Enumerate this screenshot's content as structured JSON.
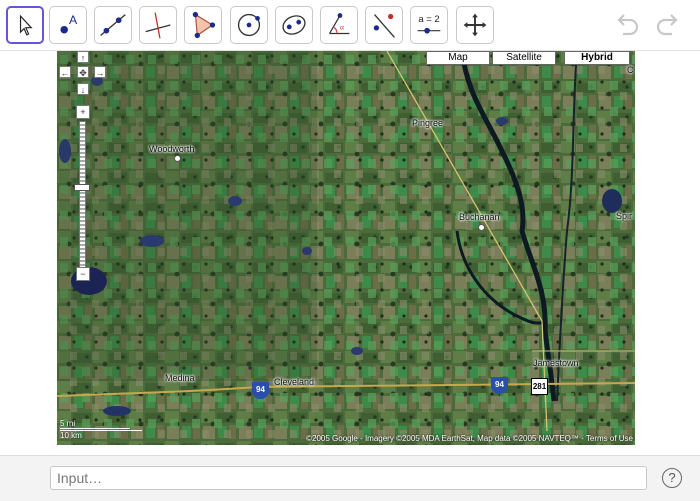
{
  "toolbar": {
    "tools": [
      {
        "name": "move-tool",
        "label": "Move"
      },
      {
        "name": "point-tool",
        "label": "A"
      },
      {
        "name": "line-tool",
        "label": "Line"
      },
      {
        "name": "perpendicular-tool",
        "label": "Perpendicular Line"
      },
      {
        "name": "polygon-tool",
        "label": "Polygon"
      },
      {
        "name": "circle-tool",
        "label": "Circle"
      },
      {
        "name": "conic-tool",
        "label": "Conic"
      },
      {
        "name": "angle-tool",
        "label": "Angle"
      },
      {
        "name": "reflect-tool",
        "label": "Reflect"
      },
      {
        "name": "slider-tool",
        "label": "a = 2"
      },
      {
        "name": "move-view-tool",
        "label": "Move Graphics View"
      }
    ],
    "undo_icon": "undo-icon",
    "redo_icon": "redo-icon"
  },
  "map": {
    "types": [
      "Map",
      "Satellite",
      "Hybrid"
    ],
    "selected_type": "Hybrid",
    "places": [
      {
        "label": "Woodworth"
      },
      {
        "label": "Pingree"
      },
      {
        "label": "Buchanan"
      },
      {
        "label": "Jamestown"
      },
      {
        "label": "Medina"
      },
      {
        "label": "Cleveland"
      },
      {
        "label": "Spir"
      },
      {
        "label": "C"
      }
    ],
    "highways": [
      "94",
      "94",
      "281"
    ],
    "scale": {
      "top": "5 mi",
      "bottom": "10 km"
    },
    "copyright": "©2005 Google - Imagery ©2005 MDA EarthSat, Map data ©2005 NAVTEQ™ - Terms of Use",
    "zoom_level_fraction": 0.57,
    "nav": {
      "up": "↑",
      "left": "←",
      "center": "✥",
      "right": "→",
      "down": "↓",
      "zoom_in": "+",
      "zoom_out": "−"
    }
  },
  "input": {
    "placeholder": "Input…",
    "help": "?"
  }
}
